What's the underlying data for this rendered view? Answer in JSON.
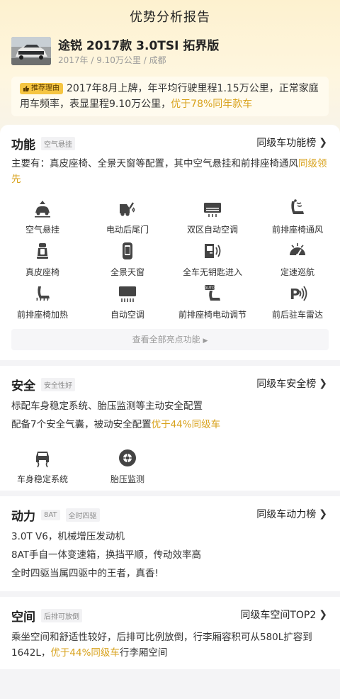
{
  "page": {
    "title": "优势分析报告"
  },
  "car": {
    "name": "途锐 2017款 3.0TSI 拓界版",
    "meta": "2017年 / 9.10万公里 / 成都"
  },
  "reason": {
    "tag": "推荐理由",
    "text_main": "2017年8月上牌，年平均行驶里程1.15万公里，正常家庭用车频率，表显里程9.10万公里，",
    "text_highlight": "优于78%同年款车"
  },
  "features": {
    "title": "功能",
    "tag": "空气悬挂",
    "rank": "同级车功能榜",
    "desc_main": "主要有：真皮座椅、全景天窗等配置，其中空气悬挂和前排座椅通风",
    "desc_highlight": "同级领先",
    "items": [
      {
        "label": "空气悬挂",
        "icon": "air-suspension"
      },
      {
        "label": "电动后尾门",
        "icon": "power-tailgate"
      },
      {
        "label": "双区自动空调",
        "icon": "dual-zone-ac"
      },
      {
        "label": "前排座椅通风",
        "icon": "seat-ventilation"
      },
      {
        "label": "真皮座椅",
        "icon": "leather-seat"
      },
      {
        "label": "全景天窗",
        "icon": "panoramic-sunroof"
      },
      {
        "label": "全车无钥匙进入",
        "icon": "keyless-entry"
      },
      {
        "label": "定速巡航",
        "icon": "cruise-control"
      },
      {
        "label": "前排座椅加热",
        "icon": "seat-heating"
      },
      {
        "label": "自动空调",
        "icon": "auto-ac"
      },
      {
        "label": "前排座椅电动调节",
        "icon": "power-seat-adjust"
      },
      {
        "label": "前后驻车雷达",
        "icon": "parking-radar"
      }
    ],
    "view_all": "查看全部亮点功能"
  },
  "safety": {
    "title": "安全",
    "tag": "安全性好",
    "rank": "同级车安全榜",
    "line1": "标配车身稳定系统、胎压监测等主动安全配置",
    "line2_main": "配备7个安全气囊，被动安全配置",
    "line2_highlight": "优于44%同级车",
    "items": [
      {
        "label": "车身稳定系统",
        "icon": "stability-control"
      },
      {
        "label": "胎压监测",
        "icon": "tire-pressure"
      }
    ]
  },
  "power": {
    "title": "动力",
    "tag1": "8AT",
    "tag2": "全时四驱",
    "rank": "同级车动力榜",
    "lines": [
      "3.0T V6，机械增压发动机",
      "8AT手自一体变速箱，换挡平顺，传动效率高",
      "全时四驱当属四驱中的王者，真香!"
    ]
  },
  "space": {
    "title": "空间",
    "tag": "后排可放倒",
    "rank": "同级车空间TOP2",
    "desc_main": "乘坐空间和舒适性较好，后排可比例放倒，行李厢容积可从580L扩容到1642L，",
    "desc_highlight": "优于44%同级车",
    "desc_tail": "行李厢空间"
  },
  "colors": {
    "accent": "#d8a21c",
    "tag_bg": "#f5c542",
    "hero": "#fdf1cf"
  }
}
